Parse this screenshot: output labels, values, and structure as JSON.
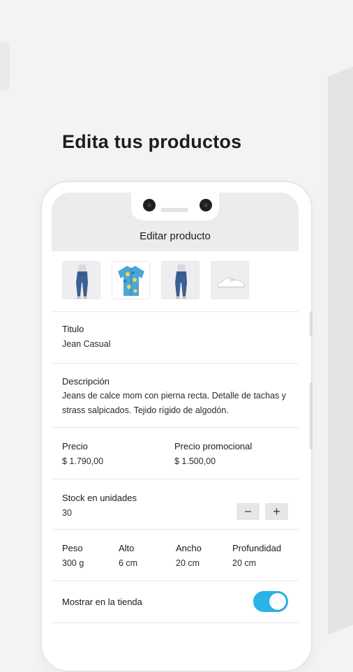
{
  "headline": "Edita tus productos",
  "screen": {
    "title": "Editar producto",
    "gallery": [
      {
        "icon": "jeans-photo"
      },
      {
        "icon": "shirt-photo"
      },
      {
        "icon": "jeans-photo"
      },
      {
        "icon": "sneaker-photo"
      }
    ],
    "titulo": {
      "label": "Titulo",
      "value": "Jean Casual"
    },
    "descripcion": {
      "label": "Descripción",
      "value": "Jeans de calce mom con pierna recta. Detalle de tachas y strass salpicados. Tejido rígido de algodón."
    },
    "precio": {
      "label": "Precio",
      "value": "$ 1.790,00"
    },
    "precio_promocional": {
      "label": "Precio promocional",
      "value": "$ 1.500,00"
    },
    "stock": {
      "label": "Stock en unidades",
      "value": "30",
      "minus": "−",
      "plus": "+"
    },
    "dimensions": [
      {
        "label": "Peso",
        "value": "300 g"
      },
      {
        "label": "Alto",
        "value": "6 cm"
      },
      {
        "label": "Ancho",
        "value": "20 cm"
      },
      {
        "label": "Profundidad",
        "value": "20 cm"
      }
    ],
    "mostrar": {
      "label": "Mostrar en la tienda",
      "on": true,
      "toggle_color": "#29b3e6"
    }
  }
}
